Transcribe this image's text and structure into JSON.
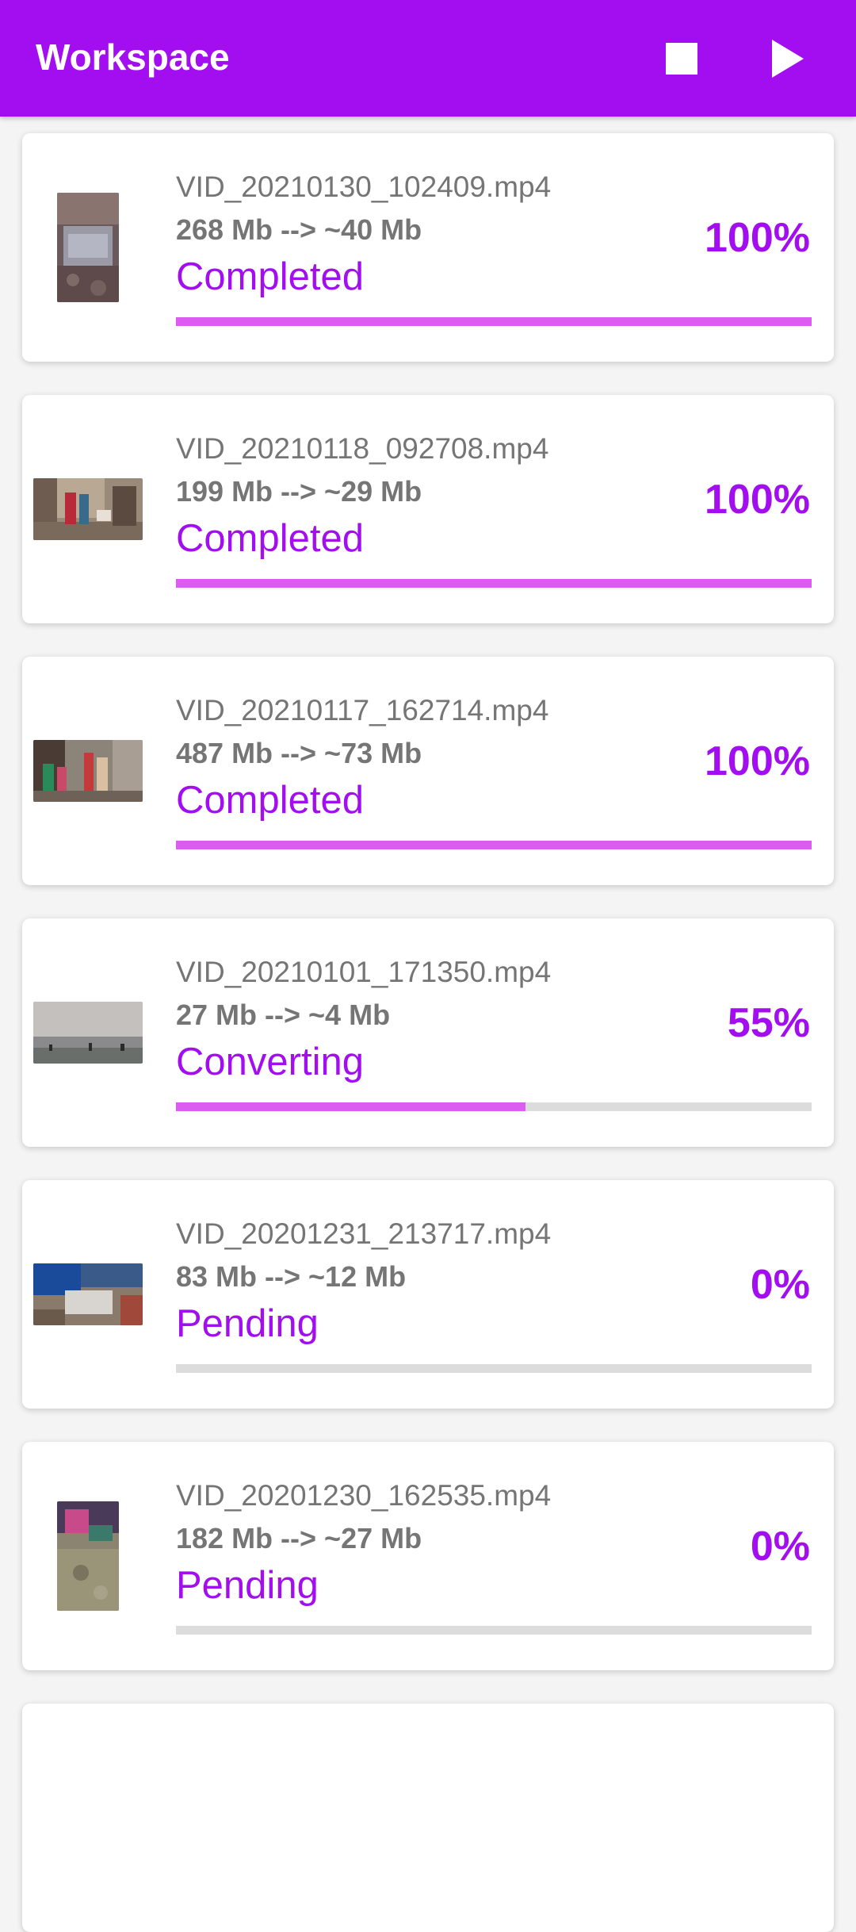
{
  "appbar": {
    "title": "Workspace",
    "stop_icon": "stop-icon",
    "play_icon": "play-icon",
    "background": "#a20ef0"
  },
  "colors": {
    "accent": "#a20ef0",
    "progress_fill": "#dc5bf0",
    "progress_track": "#dcdcdc",
    "text_secondary": "#757575"
  },
  "items": [
    {
      "filename": "VID_20210130_102409.mp4",
      "size": "268 Mb --> ~40 Mb",
      "status": "Completed",
      "percent": "100%",
      "progress": 1.0,
      "orientation": "portrait"
    },
    {
      "filename": "VID_20210118_092708.mp4",
      "size": "199 Mb --> ~29 Mb",
      "status": "Completed",
      "percent": "100%",
      "progress": 1.0,
      "orientation": "landscape"
    },
    {
      "filename": "VID_20210117_162714.mp4",
      "size": "487 Mb --> ~73 Mb",
      "status": "Completed",
      "percent": "100%",
      "progress": 1.0,
      "orientation": "landscape"
    },
    {
      "filename": "VID_20210101_171350.mp4",
      "size": "27 Mb --> ~4 Mb",
      "status": "Converting",
      "percent": "55%",
      "progress": 0.55,
      "orientation": "landscape"
    },
    {
      "filename": "VID_20201231_213717.mp4",
      "size": "83 Mb --> ~12 Mb",
      "status": "Pending",
      "percent": "0%",
      "progress": 0.0,
      "orientation": "landscape"
    },
    {
      "filename": "VID_20201230_162535.mp4",
      "size": "182 Mb --> ~27 Mb",
      "status": "Pending",
      "percent": "0%",
      "progress": 0.0,
      "orientation": "portrait"
    }
  ]
}
